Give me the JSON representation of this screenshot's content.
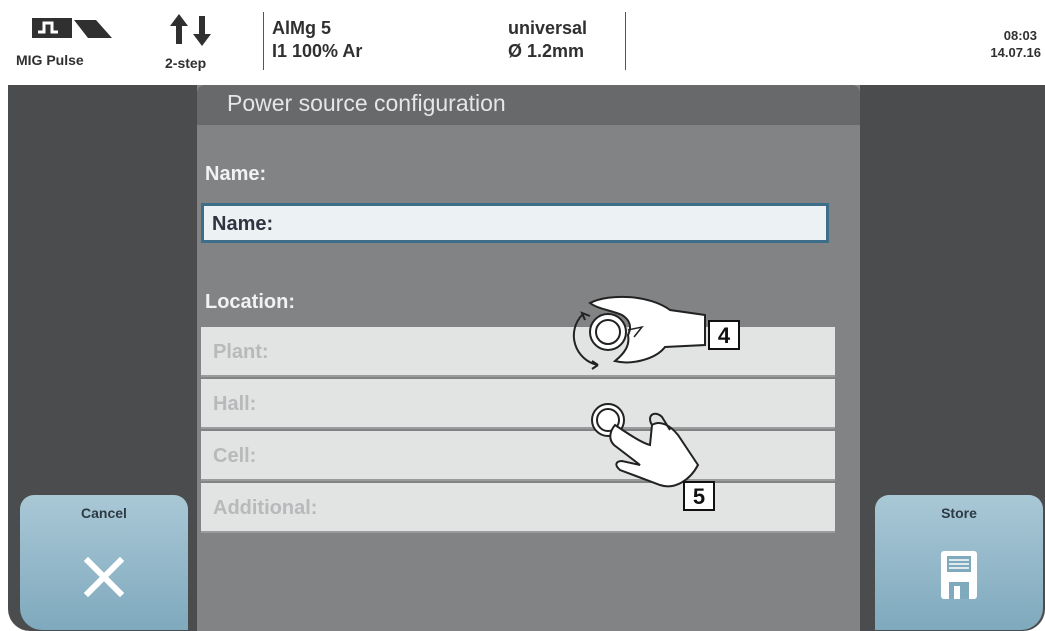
{
  "status_bar": {
    "mode": "MIG Pulse",
    "trigger_mode": "2-step",
    "material_line1": "AlMg 5",
    "material_line2": "I1 100% Ar",
    "wire_type": "universal",
    "wire_diameter": "Ø  1.2mm",
    "time": "08:03",
    "date": "14.07.16"
  },
  "dialog": {
    "title": "Power source configuration",
    "name_label": "Name:",
    "name_field_value": "Name:",
    "location_label": "Location:",
    "location_fields": [
      {
        "label": "Plant:"
      },
      {
        "label": "Hall:"
      },
      {
        "label": "Cell:"
      },
      {
        "label": "Additional:"
      }
    ]
  },
  "buttons": {
    "cancel_label": "Cancel",
    "store_label": "Store"
  },
  "callouts": [
    "4",
    "5"
  ],
  "colors": {
    "background": "#4b4c4e",
    "dialog": "#818385",
    "input_border": "#3d6e89",
    "softkey": "#a9c8d6"
  }
}
